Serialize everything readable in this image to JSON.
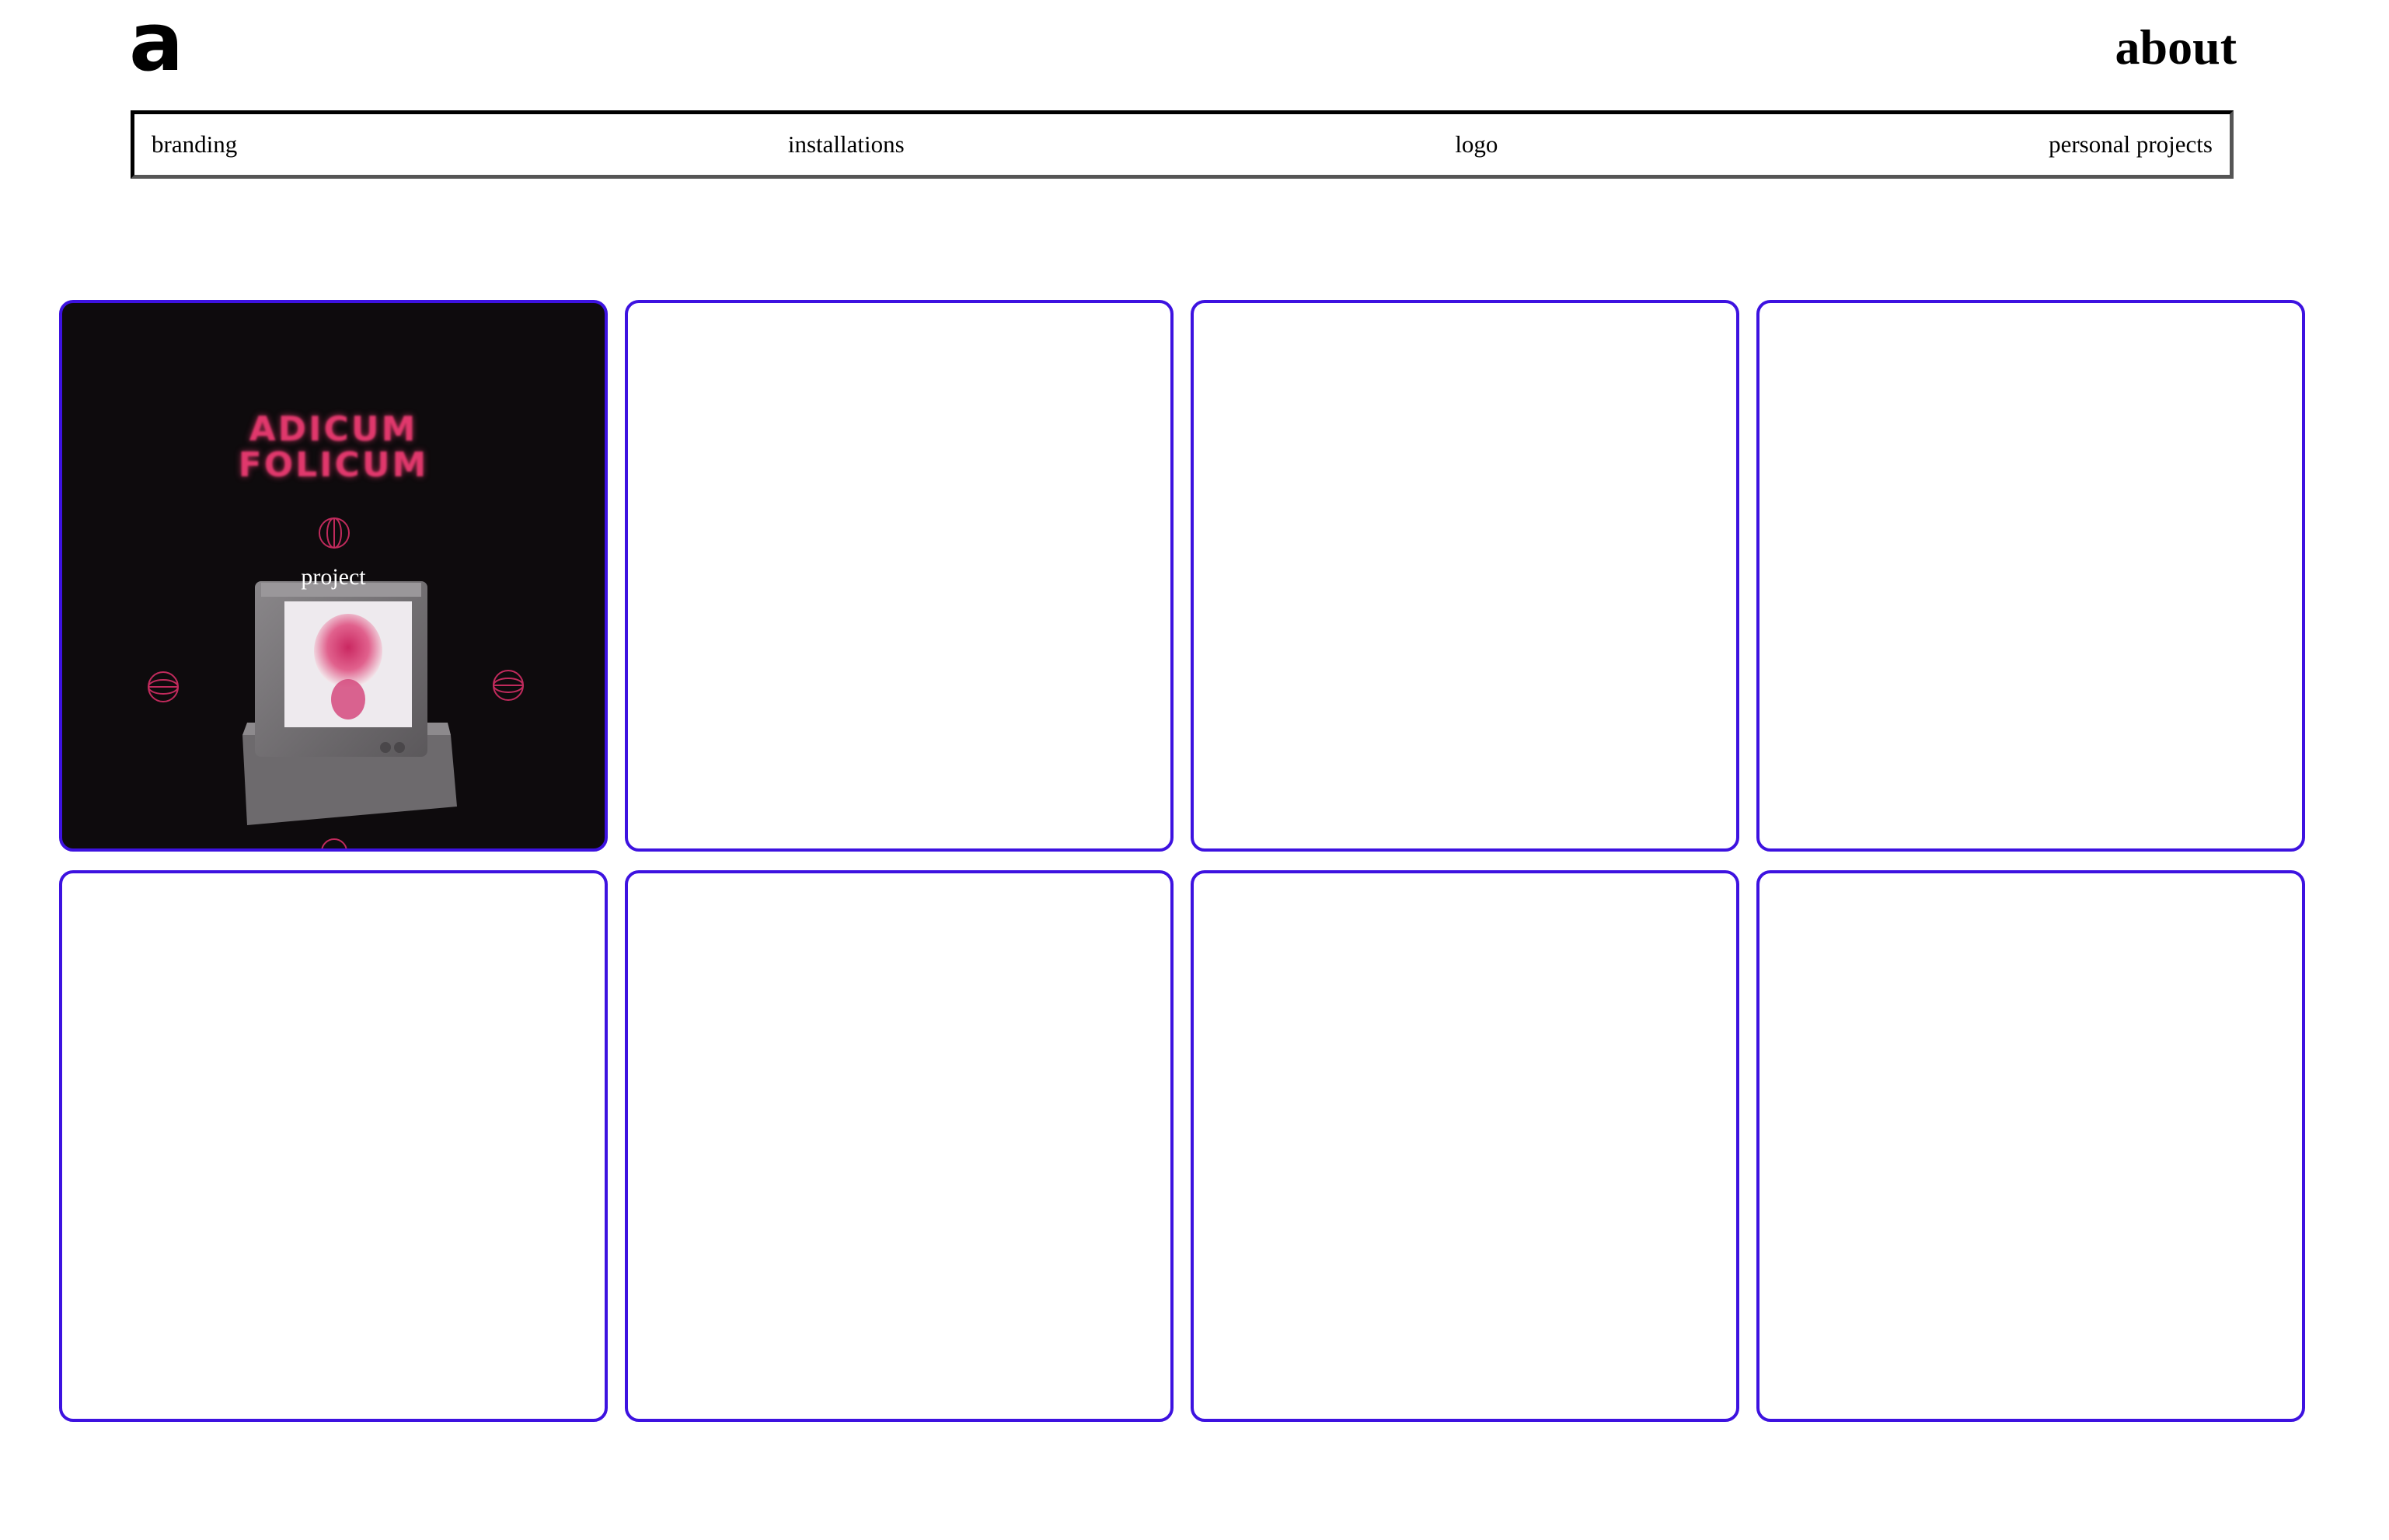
{
  "header": {
    "logo": "a",
    "about_link": "about"
  },
  "nav": {
    "items": [
      {
        "label": "branding"
      },
      {
        "label": "installations"
      },
      {
        "label": "logo"
      },
      {
        "label": "personal projects"
      }
    ]
  },
  "projects": [
    {
      "cover_title_line1": "ADICUM",
      "cover_title_line2": "FOLICUM",
      "hover_label": "project"
    },
    {},
    {},
    {},
    {},
    {},
    {},
    {}
  ],
  "colors": {
    "card_border": "#3d12e0",
    "cover_background": "#0e0b0d",
    "cover_accent": "#e0386c"
  }
}
